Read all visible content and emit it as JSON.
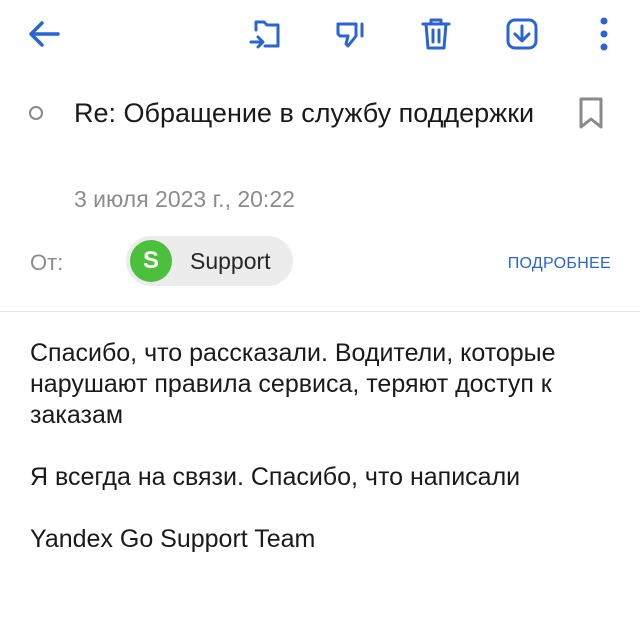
{
  "toolbar": {
    "icons": [
      "back-arrow-icon",
      "move-to-folder-icon",
      "not-spam-icon",
      "delete-icon",
      "download-icon",
      "more-vertical-icon"
    ],
    "accent_color": "#2a64d3"
  },
  "email": {
    "subject": "Re: Обращение в службу поддержки",
    "date": "3 июля 2023 г., 20:22",
    "from_label": "От:",
    "sender": {
      "initial": "S",
      "name": "Support",
      "avatar_color": "#4cbf3d"
    },
    "details_link": "ПОДРОБНЕЕ",
    "body": {
      "paragraph_1": "Спасибо, что рассказали. Водители, которые нарушают правила сервиса, теряют доступ к заказам",
      "paragraph_2": "Я всегда на связи. Спасибо, что написали",
      "signature": "Yandex Go Support Team"
    }
  }
}
